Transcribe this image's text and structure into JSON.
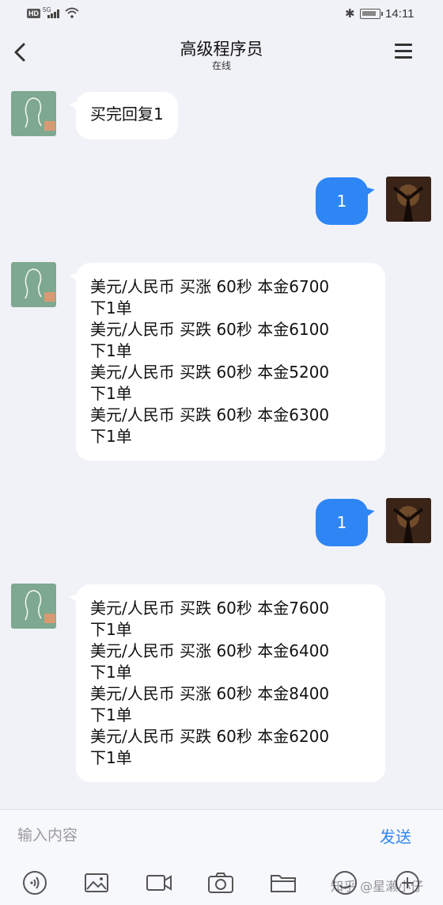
{
  "status_bar": {
    "hd": "HD",
    "network": "5G",
    "time": "14:11"
  },
  "header": {
    "title": "高级程序员",
    "status": "在线"
  },
  "messages": [
    {
      "from": "them",
      "text": "买完回复1"
    },
    {
      "from": "me",
      "text": "1"
    },
    {
      "from": "them",
      "text": "美元/人民币 买涨 60秒 本金6700\n下1单\n美元/人民币 买跌 60秒 本金6100\n下1单\n美元/人民币 买跌 60秒 本金5200\n下1单\n美元/人民币 买跌 60秒 本金6300\n下1单"
    },
    {
      "from": "me",
      "text": "1"
    },
    {
      "from": "them",
      "text": "美元/人民币 买跌 60秒 本金7600\n下1单\n美元/人民币 买涨 60秒 本金6400\n下1单\n美元/人民币 买涨 60秒 本金8400\n下1单\n美元/人民币 买跌 60秒 本金6200\n下1单"
    }
  ],
  "input": {
    "placeholder": "输入内容",
    "send_label": "发送"
  },
  "toolbar": [
    "voice-icon",
    "image-icon",
    "video-icon",
    "camera-icon",
    "folder-icon",
    "emoji-icon",
    "more-icon"
  ],
  "watermark": "知乎 @星濑小仔",
  "colors": {
    "accent": "#2e86f5",
    "background": "#f1f2f7",
    "bubble_in": "#ffffff"
  }
}
